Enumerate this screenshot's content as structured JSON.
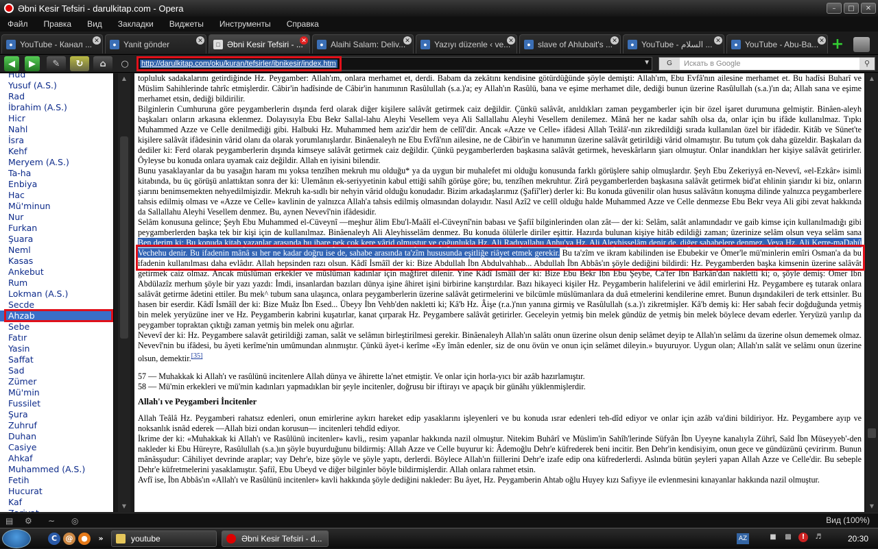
{
  "window": {
    "title": "Əbni Kesir Tefsiri - darulkitap.com - Opera"
  },
  "menu": [
    "Файл",
    "Правка",
    "Вид",
    "Закладки",
    "Виджеты",
    "Инструменты",
    "Справка"
  ],
  "tabs": [
    {
      "label": "YouTube - Канал ...",
      "favicon": "globe-icon"
    },
    {
      "label": "Yanit gönder",
      "favicon": "globe-icon"
    },
    {
      "label": "Əbni Kesir Tefsiri - ...",
      "favicon": "page-icon",
      "active": true
    },
    {
      "label": "Alaihi Salam: Deliv...",
      "favicon": "globe-icon"
    },
    {
      "label": "Yazıyı düzenle ‹ ve...",
      "favicon": "globe-icon"
    },
    {
      "label": "slave of Ahlubait's ...",
      "favicon": "globe-icon"
    },
    {
      "label": "YouTube - السلام ...",
      "favicon": "globe-icon"
    },
    {
      "label": "YouTube - Abu-Ba...",
      "favicon": "globe-icon"
    }
  ],
  "address": {
    "url": "http://darulkitap.com/oku/kuran/tefsirler/ibnikesir/index.htm"
  },
  "search": {
    "placeholder": "Искать в Google",
    "engine": "G"
  },
  "sidebar": {
    "items": [
      "Hud",
      "Yusuf (A.S.)",
      "Rad",
      "İbrahim (A.S.)",
      "Hicr",
      "Nahl",
      "İsra",
      "Kehf",
      "Meryem (A.S.)",
      "Ta-ha",
      "Enbiya",
      "Hac",
      "Mü'minun",
      "Nur",
      "Furkan",
      "Şuara",
      "Neml",
      "Kasas",
      "Ankebut",
      "Rum",
      "Lokman (A.S.)",
      "Secde",
      "Ahzab",
      "Sebe",
      "Fatır",
      "Yasin",
      "Saffat",
      "Sad",
      "Zümer",
      "Mü'min",
      "Fussilet",
      "Şura",
      "Zuhruf",
      "Duhan",
      "Casiye",
      "Ahkaf",
      "Muhammed (A.S.)",
      "Fetih",
      "Hucurat",
      "Kaf",
      "Zariyat"
    ],
    "selected": "Ahzab"
  },
  "content": {
    "p1": "topluluk sadakalarını getirdiğinde Hz. Peygamber: Allah'ım, onlara merhamet et, derdi. Babam da zekâtını kendisine götürdüğünde şöyle demişti: Allah'ım, Ebu Evfâ'nın ailesine merhamet et. Bu hadîsi Buharî ve Müslim Sahihlerinde tahrîc etmişlerdir. Câbir'in hadîsinde de Câbir'in hanımının Rasûlullah (s.a.)'a; ey Allah'ın Rasûlü, bana ve eşime merhamet dile, dediği bunun üzerine Rasûlullah (s.a.)'ın da; Allah sana ve eşime merhamet etsin, dediği bildirilir.",
    "p2": "Bilginlerin Cumhuruna göre peygamberlerin dışında ferd olarak diğer kişilere salâvât getirmek caiz değildir. Çünkü salâvât, anıldıkları zaman peygamberler için bir özel işaret durumuna gelmiştir. Binâen-aleyh başkaları onların arkasına eklenmez. Dolayısıyla Ebu Bekr Sallal-lahu Aleyhi Vesellem veya Ali Sallallahu Aleyhi Vesellem denilemez. Mânâ her ne kadar sahîh olsa da, onlar için bu ifâde kullanılmaz. Tıpkı Muhammed Azze ve Celle denilmediği gibi. Halbuki Hz. Muhammed hem aziz'dir hem de celîl'dir. Ancak «Azze ve Celle» ifâdesi Allah Teâlâ'-nın zikredildiği sırada kullanılan özel bir ifâdedir. Kitâb ve Sünet'te kişilere salâvât ifâdesinin vârid olanı da olarak yorumlanışlardır. Binâenaleyh ne Ebu Evfâ'nın ailesine, ne de Câbir'in ve hanımının üzerine salâvât getirildiği vârid olmamıştır. Bu tutum çok daha güzeldir. Başkaları da dediler ki: Ferd olarak peygamberlerin dışında kimseye salâvât getirmek caiz değildir. Çünkü peygamberlerden başkasına salâvât getirmek, heveskârların şiarı olmuştur. Onlar inandıkları her kişiye salâvât getirirler. Öyleyse bu konuda onlara uyamak caiz değildir. Allah en iyisini bilendir.",
    "p3": "Bunu yasaklayanlar da bu yasağın haram mı yoksa tenzîhen mekruh mu olduğu* ya da uygun bir muhalefet mi olduğu konusunda farklı görüşlere sahip olmuşlardır. Şeyh Ebu Zekeriyyâ en-Nevevî, «el-Ezkâr» isimli kitabında, bu üç görüşü anlattıktan sonra der ki: Ulemânın ek-seriyyetinin kabul ettiği sahîh görüşe göre; bu, tenzîhen mekruhtur. Zirâ peygamberlerden başkasına salâvât getirmek bid'at ehlinin şiarıdır ki biz, onların şiarını benimsemekten nehyedilmişizdir. Mekruh ka-sıdlı bir nehyin vârid olduğu konudadır. Bizim arkadaşlarımız (Şafiî'ler) derler ki: Bu konuda güvenilir olan husus salâvâtın konuşma dilinde yalnızca peygamberlere tahsis edilmiş olması ve «Azze ve Celle» kavlinin de yalnızca Allah'a tahsis edilmiş olmasından dolayıdır. Nasıl Azî2 ve celîl olduğu halde Muhammed Azze ve Celle denmezse Ebu Bekr veya Ali gibi zevat hakkında da Sallallahu Aleyhi Vesellem denmez. Bu, aynen Nevevî'nin ifâdesidir.",
    "p4": "Selâm konusuna gelince; Şeyh Ebu Muhammed el-Cüveynî —meşhur âlim Ebu'l-Maâlî el-Cüveynî'nin babası ve Şafiî bilginlerinden olan zât— der ki: Selâm, salât anlamındadır ve gaib kimse için kullanılmadığı gibi peygamberlerden başka tek bir kişi için de kullanılmaz. Binâenaleyh Ali Aleyhisselâm denmez. Bu konuda ölülerle diriler eşittir. Hazırda bulunan kişiye hitâb edildiği zaman; üzerinize selâm olsun veya selâm sana veya sana ve siz e selâm olsun gibi ifâdeler kullanılır. Bu konuda icmâ' vardır. Cüveynî'nin ifâdesi burada son buldu.",
    "hl": "Ben derim ki: Bu konuda kitab yazanlar arasında bu ibare pek çok kere vârid olmuştur ve çoğunlukla Hz. Ali Radıyallahu Anhu'ya Hz. Ali Aleyhisselâm denir de, diğer sahabelere denmez. Veya Hz. Ali Kerre-maDahû Vechehu denir. Bu ifadenin mânâ sı her ne kadar doğru ise de, sahabe arasında ta'zîm hususunda eşitliğe riâyet etmek gerekir.",
    "p5tail": " Bu ta'zîm ve ikram kabilinden ise Ebubekir ve Ömer'le mü'minlerin emîri Osman'a da bu ifadenin kullanılması daha evlâdır. Allah hepsinden razı olsun. Kâdî İsmâîl der ki: Bize Abdullah İbn Abdulvahhab... Abdullah İbn Abbâs'ın şöyle dediğini bildirdi: Hz. Peygamberden başka kimsenin üzerine salâvât getirmek caiz olmaz. Ancak müslüman erkekler ve müslüman kadınlar için mağfiret dilenir. Yine Kâdî İsmâîl der ki: Bize Ebu Bekr İbn Ebu Şeybe, Ca'fer İbn Barkân'dan nakletti ki; o, şöyle demiş: Ömer İbn Abdülazîz merhum şöyle bir yazı yazdı: İmdi, insanlardan bazıları dünya işine âhiret işini birbirine karıştırdılar. Bazı hikayeci kişiler Hz. Peygamberin halifelerini ve âdil emirlerini Hz. Peygambere eş tutarak onlara salâvât getirme âdetini ettiler. Bu mek^ tubum sana ulaşınca, onlara peygamberlerin üzerine salâvât getirmelerini ve bilcümle müslümanlara da duâ etmelerini kendilerine emret. Bunun dışındakileri de terk ettsinler. Bu hasen bir eserdir. Kâdî İsmâîl der ki: Bize Muâz İbn Esed... Übeyy İbn Vehb'den nakletti ki; Kâ'b Hz. Âişe (r.a.)'nın yanına girmiş ve Rasûlullah (s.a.)'ı zikretmişler. Kâ'b demiş ki: Her sabah fecir doğduğunda yetmiş bin melek yeryüzüne iner ve Hz. Peygamberin kabrini kuşatırlar, kanat çırparak Hz. Peygambere salâvât getirirler. Geceleyin yetmiş bin melek gündüz de yetmiş bin melek böylece devam ederler. Yeryüzü yarılıp da peygamber topraktan çıktığı zaman yetmiş bin melek onu ağırlar.",
    "p6": "Nevevî der ki: Hz. Peygambere salavât getirildiği zaman, salât ve selâmın birleştirilmesi gerekir. Binâenaleyh Allah'ın salâtı onun üzerine olsun denip selâmet deyip te Allah'ın selâmı da üzerine olsun dememek olmaz. Nevevî'nin bu ifâdesi, bu âyeti kerîme'nin umûmundan alınmıştır. Çünkü âyet-i kerîme «Ey îmân edenler, siz de onu övün ve onun için selâmet dileyin.» buyuruyor. Uygun olan; Allah'ın salât ve selâmı onun üzerine olsun, demektir.",
    "ref": "[35]",
    "v57": "57  — Muhakkak ki Allah'ı ve rasûlünü incitenlere Allah dünya ve âhirette la'net etmiştir. Ve onlar için horla-yıcı bir azâb hazırlamıştır.",
    "v58": "58  — Mü'min erkekleri ve mü'min   kadınları   yapmadıklan bir şeyle incitenler, doğrusu bir iftirayı ve apaçık bir günâhı yüklenmişlerdir.",
    "heading": "Allah'ı ve  Peygamberi İncitenler",
    "p7": "Allah Teâlâ Hz. Peygamberi rahatsız edenleri, onun emirlerine aykırı hareket edip yasaklarını işleyenleri ve bu konuda ısrar edenleri teh-dîd ediyor ve onlar için azâb va'dini bildiriyor. Hz. Peygambere ayıp ve noksanlık isnâd ederek —Allah bizi ondan korusun— incitenleri tehdîd ediyor.",
    "p8": "İkrime der ki: «Muhakkak ki Allah'ı ve Rasûlünü incitenler» kavli,, resim yapanlar hakkında nazil olmuştur. Nitekim Buhârî ve Müslim'in Sahîh'lerinde Süfyân İbn Uyeyne kanalıyla Zührî, Saîd İbn Müseyyeb'-den nakleder ki Ebu Hüreyre, Rasûlullah (s.a.)ın şöyle buyurduğunu bildirmiş: Allah Azze ve Celle buyurur ki: Âdemoğlu Dehr'e küfrederek beni incitir. Ben Dehr'in kendisiyim, onun gece ve gündüzünü çevirirım. Bunun mânâsşudur: Câhiliyet devrinde araplar; vay Dehr'e, bize şöyle ve şöyle yaptı, derlerdi. Böylece Allah'ın fiillerini Dehr'e izafe edip ona küfrederlerdi. Aslında bütün şeyleri yapan Allah Azze ve Celle'dir. Bu sebeple Dehr'e küfretmelerini yasaklamıştır. Şafiî, Ebu Ubeyd ve diğer bilginler böyle bildirmişlerdir. Allah onlara rahmet etsin.",
    "p9": "Avfî ise, İbn Abbâs'ın «Allah'ı ve Rasûlünü incitenler» kavli hakkında şöyle dediğini nakleder: Bu âyet, Hz. Peygamberin Ahtab oğlu Huyey kızı Safiyye ile evlenmesini kınayanlar hakkında nazil olmuştur."
  },
  "status": {
    "zoom": "Вид (100%)"
  },
  "taskbar": {
    "tasks": [
      {
        "label": "youtube",
        "icon": "folder-icon"
      },
      {
        "label": "Əbni Kesir Tefsiri - d...",
        "icon": "opera-icon",
        "active": true
      }
    ],
    "lang": "AZ",
    "clock": "20:30"
  }
}
